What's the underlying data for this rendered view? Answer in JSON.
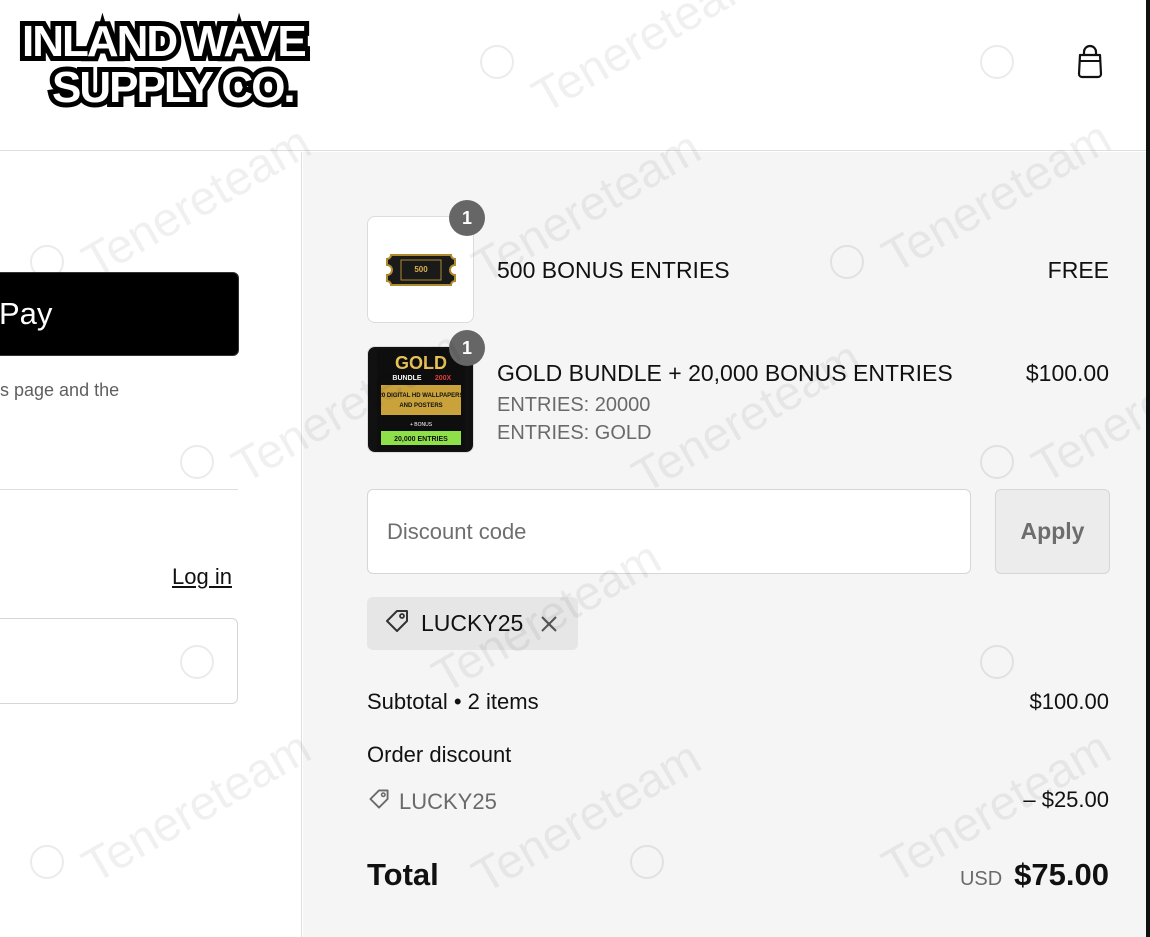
{
  "header": {
    "logo_line1": "INLAND WAVE",
    "logo_line2": "SUPPLY CO."
  },
  "express": {
    "pay_label": "Pay",
    "note": "s page and the"
  },
  "contact": {
    "login_label": "Log in"
  },
  "summary": {
    "items": [
      {
        "quantity": "1",
        "name": "500 BONUS ENTRIES",
        "price": "FREE",
        "thumb_text": "500"
      },
      {
        "quantity": "1",
        "name": "GOLD BUNDLE + 20,000 BONUS ENTRIES",
        "price": "$100.00",
        "meta1": "ENTRIES: 20000",
        "meta2": "ENTRIES: GOLD",
        "thumb_title": "GOLD",
        "thumb_sub": "BUNDLE",
        "thumb_badge": "200X",
        "thumb_desc1": "20 DIGITAL HD WALLPAPERS",
        "thumb_desc2": "AND POSTERS",
        "thumb_bonus": "+ BONUS",
        "thumb_entries": "20,000 ENTRIES"
      }
    ],
    "discount": {
      "placeholder": "Discount code",
      "apply_label": "Apply",
      "applied_code": "LUCKY25"
    },
    "subtotal_label": "Subtotal • 2 items",
    "subtotal_value": "$100.00",
    "order_discount_label": "Order discount",
    "order_discount_code": "LUCKY25",
    "order_discount_value": "– $25.00",
    "total_label": "Total",
    "total_currency": "USD",
    "total_value": "$75.00"
  },
  "watermark": {
    "text": "Tenereteam"
  },
  "colors": {
    "summary_bg": "#f5f5f5",
    "badge_bg": "#666666",
    "button_dark": "#000000"
  }
}
